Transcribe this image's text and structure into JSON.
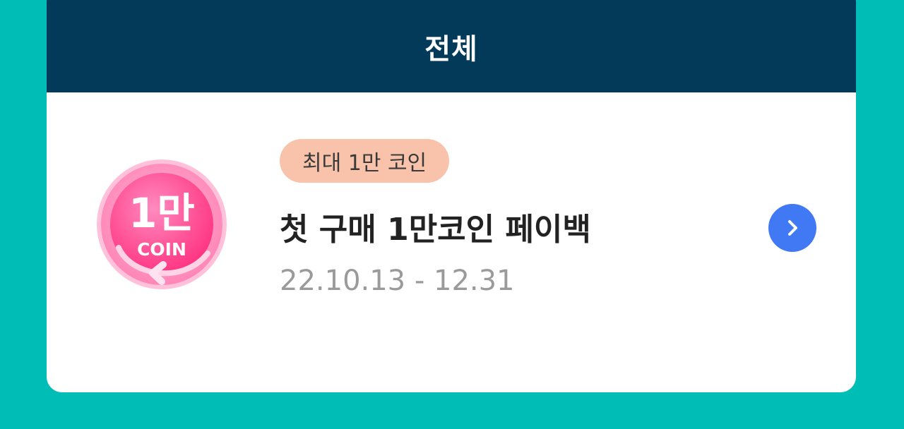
{
  "header": {
    "title": "전체"
  },
  "event": {
    "badge": "최대 1만 코인",
    "title": "첫 구매 1만코인 페이백",
    "date": "22.10.13 - 12.31",
    "coin_icon": {
      "amount_text": "1만",
      "label": "COIN"
    },
    "arrow_icon": "chevron-right-icon"
  },
  "colors": {
    "background": "#00BDB5",
    "header": "#043A59",
    "badge": "#F8C3AA",
    "arrow_button": "#4179F5",
    "coin_pink": "#FF4C94"
  }
}
